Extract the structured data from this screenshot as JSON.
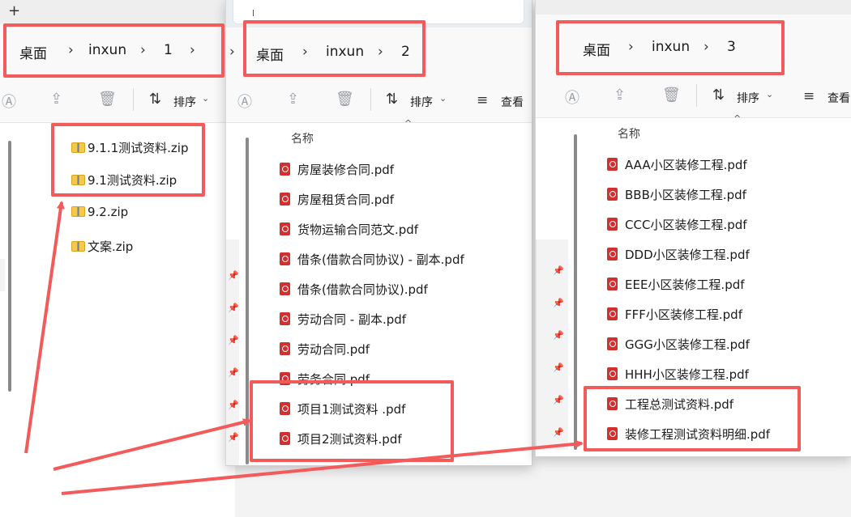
{
  "colors": {
    "highlight": "#f35b5b",
    "arrow": "#f35b5b"
  },
  "windows": [
    {
      "breadcrumb": [
        "桌面",
        "inxun",
        "1"
      ],
      "toolbar": {
        "sort_label": "排序"
      },
      "files": [
        "9.1.1测试资料.zip",
        "9.1测试资料.zip",
        "9.2.zip",
        "文案.zip"
      ]
    },
    {
      "breadcrumb": [
        "桌面",
        "inxun",
        "2"
      ],
      "toolbar": {
        "sort_label": "排序",
        "view_label": "查看"
      },
      "column_header": "名称",
      "files": [
        "房屋装修合同.pdf",
        "房屋租赁合同.pdf",
        "货物运输合同范文.pdf",
        "借条(借款合同协议) - 副本.pdf",
        "借条(借款合同协议).pdf",
        "劳动合同 - 副本.pdf",
        "劳动合同.pdf",
        "劳务合同.pdf",
        "项目1测试资料 .pdf",
        "项目2测试资料.pdf"
      ]
    },
    {
      "breadcrumb": [
        "桌面",
        "inxun",
        "3"
      ],
      "toolbar": {
        "sort_label": "排序",
        "view_label": "查看"
      },
      "column_header": "名称",
      "files": [
        "AAA小区装修工程.pdf",
        "BBB小区装修工程.pdf",
        "CCC小区装修工程.pdf",
        "DDD小区装修工程.pdf",
        "EEE小区装修工程.pdf",
        "FFF小区装修工程.pdf",
        "GGG小区装修工程.pdf",
        "HHH小区装修工程.pdf",
        "工程总测试资料.pdf",
        "装修工程测试资料明细.pdf"
      ]
    }
  ]
}
